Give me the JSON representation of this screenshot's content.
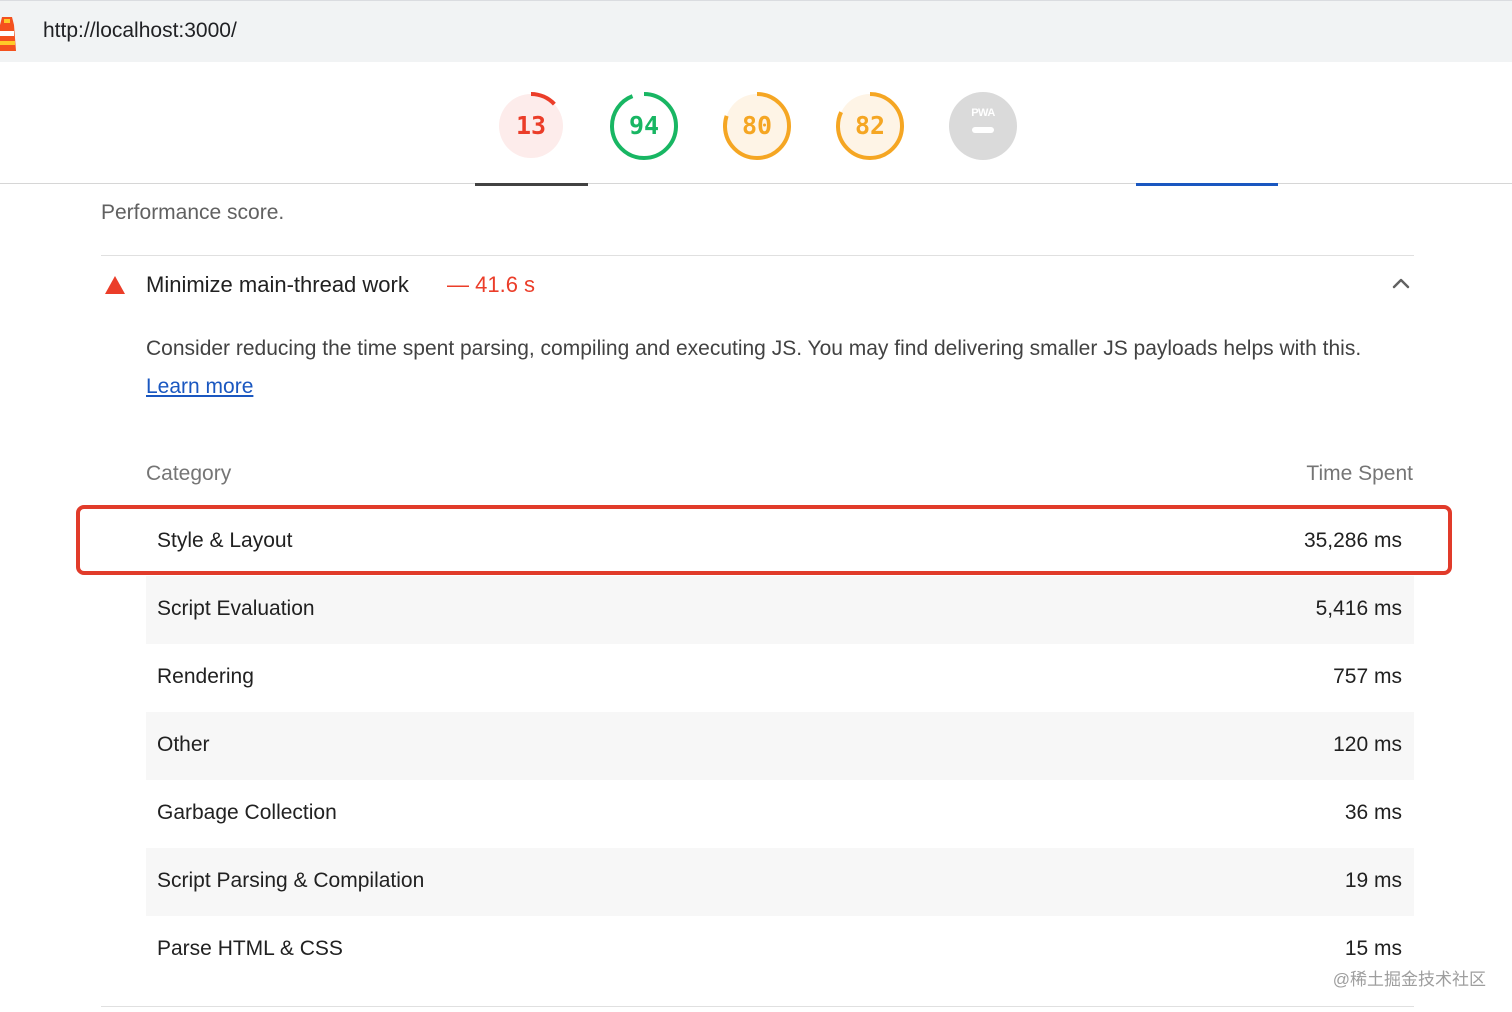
{
  "browser": {
    "url": "http://localhost:3000/"
  },
  "scores": [
    {
      "value": "13",
      "fraction": 0.13,
      "color": "#eb3d29",
      "bg": "#fdeceb",
      "category": "performance"
    },
    {
      "value": "94",
      "fraction": 0.94,
      "color": "#18b663",
      "bg": "#ffffff",
      "category": "accessibility"
    },
    {
      "value": "80",
      "fraction": 0.8,
      "color": "#f5a623",
      "bg": "#fef4e6",
      "category": "best-practices"
    },
    {
      "value": "82",
      "fraction": 0.82,
      "color": "#f5a623",
      "bg": "#fef4e6",
      "category": "seo"
    }
  ],
  "pwa": {
    "label": "PWA",
    "bg": "#dadada"
  },
  "perf_note": "Performance score.",
  "audit": {
    "title": "Minimize main-thread work",
    "value": "— 41.6 s",
    "description": "Consider reducing the time spent parsing, compiling and executing JS. You may find delivering smaller JS payloads helps with this.",
    "learn_more": "Learn more"
  },
  "table": {
    "headers": {
      "category": "Category",
      "time": "Time Spent"
    },
    "rows": [
      {
        "category": "Style & Layout",
        "time": "35,286 ms"
      },
      {
        "category": "Script Evaluation",
        "time": "5,416 ms"
      },
      {
        "category": "Rendering",
        "time": "757 ms"
      },
      {
        "category": "Other",
        "time": "120 ms"
      },
      {
        "category": "Garbage Collection",
        "time": "36 ms"
      },
      {
        "category": "Script Parsing & Compilation",
        "time": "19 ms"
      },
      {
        "category": "Parse HTML & CSS",
        "time": "15 ms"
      }
    ]
  },
  "watermark": "@稀土掘金技术社区",
  "colors": {
    "fail": "#eb3d29",
    "link": "#1a57c0",
    "highlight": "#e13b2a"
  }
}
